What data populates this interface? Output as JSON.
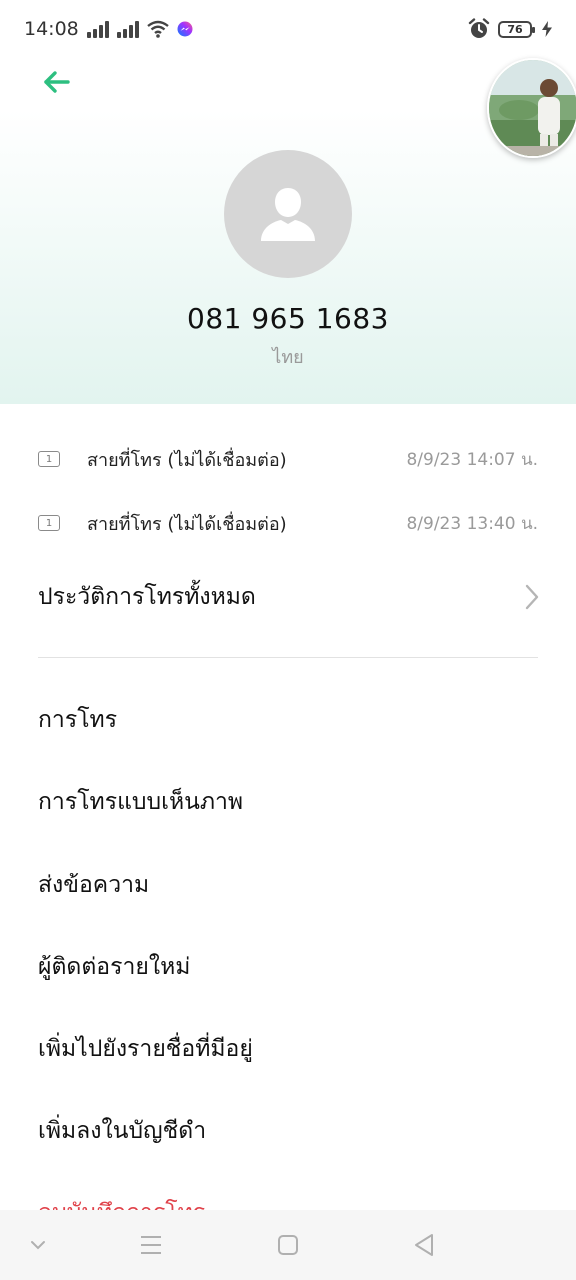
{
  "status_bar": {
    "time": "14:08",
    "battery_level": "76"
  },
  "contact": {
    "phone_number": "081 965 1683",
    "country": "ไทย"
  },
  "call_log": [
    {
      "label": "สายที่โทร (ไม่ได้เชื่อมต่อ)",
      "time": "8/9/23 14:07 น.",
      "sim": "1"
    },
    {
      "label": "สายที่โทร (ไม่ได้เชื่อมต่อ)",
      "time": "8/9/23 13:40 น.",
      "sim": "1"
    }
  ],
  "history": {
    "label": "ประวัติการโทรทั้งหมด"
  },
  "actions": {
    "call": "การโทร",
    "video_call": "การโทรแบบเห็นภาพ",
    "send_message": "ส่งข้อความ",
    "new_contact": "ผู้ติดต่อรายใหม่",
    "add_to_existing": "เพิ่มไปยังรายชื่อที่มีอยู่",
    "add_to_blacklist": "เพิ่มลงในบัญชีดำ",
    "delete_call_log": "ลบบันทึกการโทร"
  },
  "colors": {
    "accent": "#2dbf80",
    "danger": "#e0424a",
    "header_gradient_end": "#e2f4ef"
  },
  "icons": {
    "back": "arrow-left-icon",
    "contact_avatar": "person-silhouette-icon",
    "history_chevron": "chevron-right-icon"
  }
}
